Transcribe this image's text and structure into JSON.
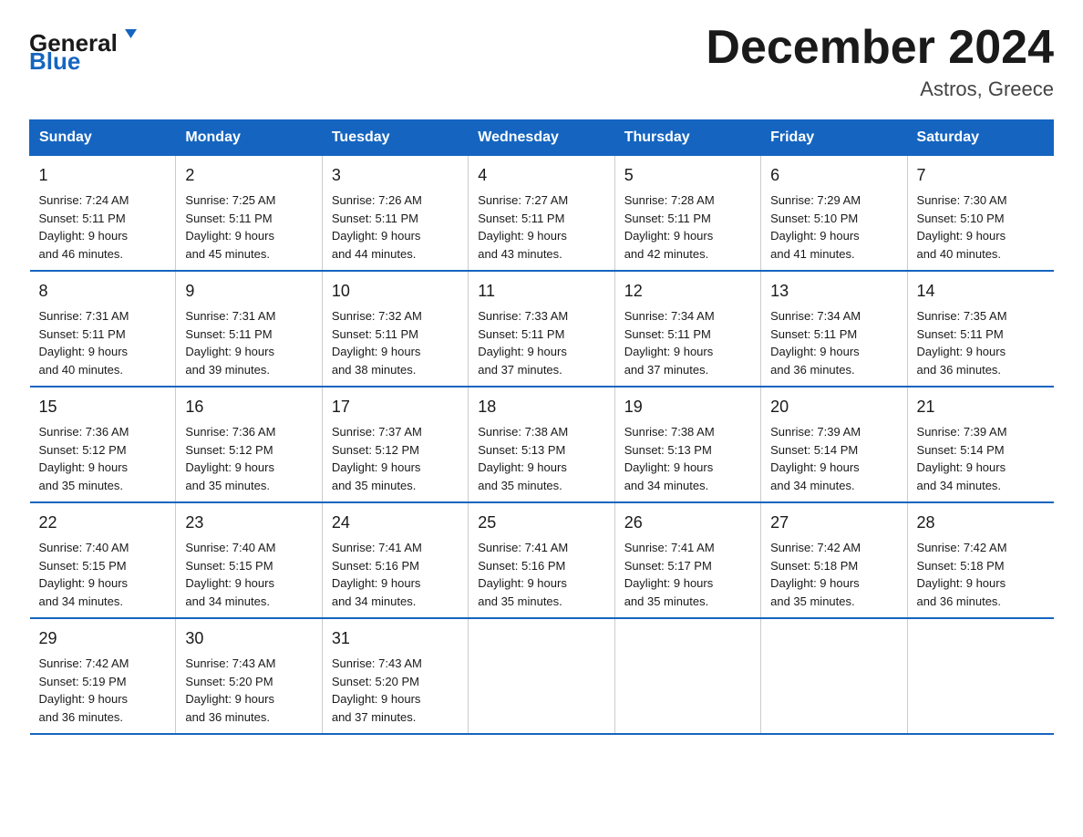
{
  "header": {
    "logo_line1": "General",
    "logo_line2": "Blue",
    "main_title": "December 2024",
    "subtitle": "Astros, Greece"
  },
  "calendar": {
    "days_of_week": [
      "Sunday",
      "Monday",
      "Tuesday",
      "Wednesday",
      "Thursday",
      "Friday",
      "Saturday"
    ],
    "weeks": [
      [
        {
          "day": "1",
          "sunrise": "7:24 AM",
          "sunset": "5:11 PM",
          "daylight": "9 hours and 46 minutes."
        },
        {
          "day": "2",
          "sunrise": "7:25 AM",
          "sunset": "5:11 PM",
          "daylight": "9 hours and 45 minutes."
        },
        {
          "day": "3",
          "sunrise": "7:26 AM",
          "sunset": "5:11 PM",
          "daylight": "9 hours and 44 minutes."
        },
        {
          "day": "4",
          "sunrise": "7:27 AM",
          "sunset": "5:11 PM",
          "daylight": "9 hours and 43 minutes."
        },
        {
          "day": "5",
          "sunrise": "7:28 AM",
          "sunset": "5:11 PM",
          "daylight": "9 hours and 42 minutes."
        },
        {
          "day": "6",
          "sunrise": "7:29 AM",
          "sunset": "5:10 PM",
          "daylight": "9 hours and 41 minutes."
        },
        {
          "day": "7",
          "sunrise": "7:30 AM",
          "sunset": "5:10 PM",
          "daylight": "9 hours and 40 minutes."
        }
      ],
      [
        {
          "day": "8",
          "sunrise": "7:31 AM",
          "sunset": "5:11 PM",
          "daylight": "9 hours and 40 minutes."
        },
        {
          "day": "9",
          "sunrise": "7:31 AM",
          "sunset": "5:11 PM",
          "daylight": "9 hours and 39 minutes."
        },
        {
          "day": "10",
          "sunrise": "7:32 AM",
          "sunset": "5:11 PM",
          "daylight": "9 hours and 38 minutes."
        },
        {
          "day": "11",
          "sunrise": "7:33 AM",
          "sunset": "5:11 PM",
          "daylight": "9 hours and 37 minutes."
        },
        {
          "day": "12",
          "sunrise": "7:34 AM",
          "sunset": "5:11 PM",
          "daylight": "9 hours and 37 minutes."
        },
        {
          "day": "13",
          "sunrise": "7:34 AM",
          "sunset": "5:11 PM",
          "daylight": "9 hours and 36 minutes."
        },
        {
          "day": "14",
          "sunrise": "7:35 AM",
          "sunset": "5:11 PM",
          "daylight": "9 hours and 36 minutes."
        }
      ],
      [
        {
          "day": "15",
          "sunrise": "7:36 AM",
          "sunset": "5:12 PM",
          "daylight": "9 hours and 35 minutes."
        },
        {
          "day": "16",
          "sunrise": "7:36 AM",
          "sunset": "5:12 PM",
          "daylight": "9 hours and 35 minutes."
        },
        {
          "day": "17",
          "sunrise": "7:37 AM",
          "sunset": "5:12 PM",
          "daylight": "9 hours and 35 minutes."
        },
        {
          "day": "18",
          "sunrise": "7:38 AM",
          "sunset": "5:13 PM",
          "daylight": "9 hours and 35 minutes."
        },
        {
          "day": "19",
          "sunrise": "7:38 AM",
          "sunset": "5:13 PM",
          "daylight": "9 hours and 34 minutes."
        },
        {
          "day": "20",
          "sunrise": "7:39 AM",
          "sunset": "5:14 PM",
          "daylight": "9 hours and 34 minutes."
        },
        {
          "day": "21",
          "sunrise": "7:39 AM",
          "sunset": "5:14 PM",
          "daylight": "9 hours and 34 minutes."
        }
      ],
      [
        {
          "day": "22",
          "sunrise": "7:40 AM",
          "sunset": "5:15 PM",
          "daylight": "9 hours and 34 minutes."
        },
        {
          "day": "23",
          "sunrise": "7:40 AM",
          "sunset": "5:15 PM",
          "daylight": "9 hours and 34 minutes."
        },
        {
          "day": "24",
          "sunrise": "7:41 AM",
          "sunset": "5:16 PM",
          "daylight": "9 hours and 34 minutes."
        },
        {
          "day": "25",
          "sunrise": "7:41 AM",
          "sunset": "5:16 PM",
          "daylight": "9 hours and 35 minutes."
        },
        {
          "day": "26",
          "sunrise": "7:41 AM",
          "sunset": "5:17 PM",
          "daylight": "9 hours and 35 minutes."
        },
        {
          "day": "27",
          "sunrise": "7:42 AM",
          "sunset": "5:18 PM",
          "daylight": "9 hours and 35 minutes."
        },
        {
          "day": "28",
          "sunrise": "7:42 AM",
          "sunset": "5:18 PM",
          "daylight": "9 hours and 36 minutes."
        }
      ],
      [
        {
          "day": "29",
          "sunrise": "7:42 AM",
          "sunset": "5:19 PM",
          "daylight": "9 hours and 36 minutes."
        },
        {
          "day": "30",
          "sunrise": "7:43 AM",
          "sunset": "5:20 PM",
          "daylight": "9 hours and 36 minutes."
        },
        {
          "day": "31",
          "sunrise": "7:43 AM",
          "sunset": "5:20 PM",
          "daylight": "9 hours and 37 minutes."
        },
        null,
        null,
        null,
        null
      ]
    ],
    "sunrise_label": "Sunrise:",
    "sunset_label": "Sunset:",
    "daylight_label": "Daylight:"
  }
}
